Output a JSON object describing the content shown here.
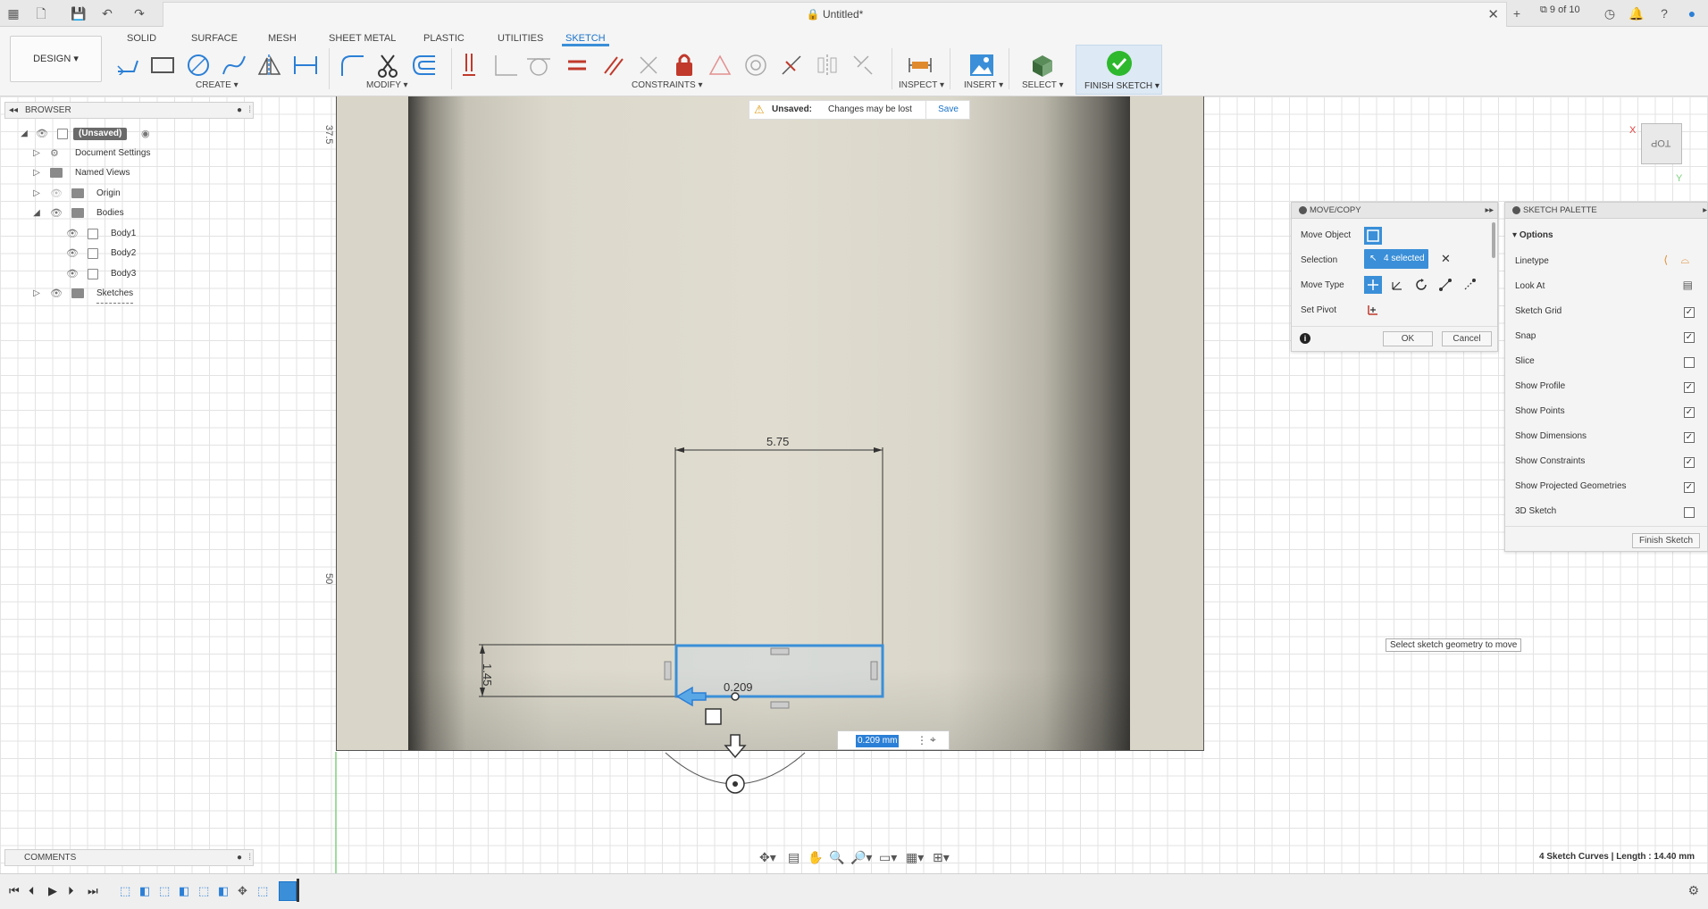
{
  "titlebar": {
    "doc_title": "Untitled*",
    "jobs": "9 of 10"
  },
  "ribbon": {
    "design_label": "DESIGN ▾",
    "tabs": [
      "SOLID",
      "SURFACE",
      "MESH",
      "SHEET METAL",
      "PLASTIC",
      "UTILITIES",
      "SKETCH"
    ],
    "active_tab": "SKETCH",
    "groups": {
      "create": "CREATE ▾",
      "modify": "MODIFY ▾",
      "constraints": "CONSTRAINTS ▾",
      "inspect": "INSPECT ▾",
      "insert": "INSERT ▾",
      "select": "SELECT ▾",
      "finish": "FINISH SKETCH ▾"
    }
  },
  "browser": {
    "title": "BROWSER",
    "items": [
      {
        "label": "(Unsaved)"
      },
      {
        "label": "Document Settings"
      },
      {
        "label": "Named Views"
      },
      {
        "label": "Origin"
      },
      {
        "label": "Bodies"
      },
      {
        "label": "Body1"
      },
      {
        "label": "Body2"
      },
      {
        "label": "Body3"
      },
      {
        "label": "Sketches"
      }
    ]
  },
  "comments": {
    "title": "COMMENTS"
  },
  "unsaved_bar": {
    "label": "Unsaved:",
    "message": "Changes may be lost",
    "save": "Save"
  },
  "rulers": {
    "top": "37.5",
    "mid": "50"
  },
  "sketch": {
    "dim_width": "5.75",
    "dim_height": "1.45",
    "dim_move": "0.209",
    "input_value": "0.209 mm"
  },
  "move_copy": {
    "title": "MOVE/COPY",
    "move_object": "Move Object",
    "selection": "Selection",
    "selection_value": "4 selected",
    "move_type": "Move Type",
    "set_pivot": "Set Pivot",
    "ok": "OK",
    "cancel": "Cancel"
  },
  "sketch_palette": {
    "title": "SKETCH PALETTE",
    "section": "Options",
    "linetype": "Linetype",
    "look_at": "Look At",
    "options": [
      {
        "label": "Sketch Grid",
        "checked": true
      },
      {
        "label": "Snap",
        "checked": true
      },
      {
        "label": "Slice",
        "checked": false
      },
      {
        "label": "Show Profile",
        "checked": true
      },
      {
        "label": "Show Points",
        "checked": true
      },
      {
        "label": "Show Dimensions",
        "checked": true
      },
      {
        "label": "Show Constraints",
        "checked": true
      },
      {
        "label": "Show Projected Geometries",
        "checked": true
      },
      {
        "label": "3D Sketch",
        "checked": false
      }
    ],
    "finish_button": "Finish Sketch"
  },
  "tooltip": "Select sketch geometry to move",
  "viewcube": {
    "face": "TOP",
    "x_axis": "X",
    "y_axis": "Y"
  },
  "status": "4 Sketch Curves | Length : 14.40 mm",
  "colors": {
    "accent": "#3a8fd8",
    "finish_green": "#2eb82e",
    "model_face": "#dcd9cc"
  }
}
